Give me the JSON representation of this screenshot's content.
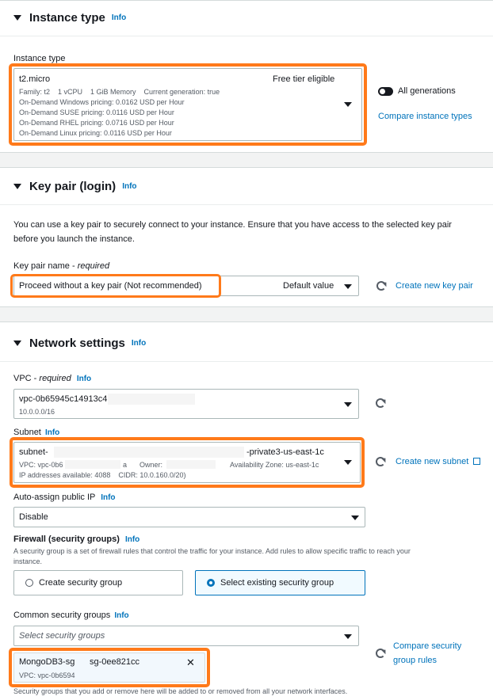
{
  "instance": {
    "title": "Instance type",
    "info": "Info",
    "field_label": "Instance type",
    "selected": "t2.micro",
    "badge": "Free tier eligible",
    "details": [
      "Family: t2    1 vCPU    1 GiB Memory    Current generation: true",
      "On-Demand Windows pricing: 0.0162 USD per Hour",
      "On-Demand SUSE pricing: 0.0116 USD per Hour",
      "On-Demand RHEL pricing: 0.0716 USD per Hour",
      "On-Demand Linux pricing: 0.0116 USD per Hour"
    ],
    "toggle_label": "All generations",
    "compare_link": "Compare instance types"
  },
  "keypair": {
    "title": "Key pair (login)",
    "info": "Info",
    "desc_line1": "You can use a key pair to securely connect to your instance. Ensure that you have access to the selected key pair",
    "desc_line2": "before you launch the instance.",
    "field_label": "Key pair name - ",
    "field_required": "required",
    "selected": "Proceed without a key pair (Not recommended)",
    "default_value": "Default value",
    "create_link": "Create new key pair"
  },
  "network": {
    "title": "Network settings",
    "info": "Info",
    "vpc_label": "VPC - ",
    "vpc_required": "required",
    "vpc_info": "Info",
    "vpc_value": "vpc-0b65945c14913c4",
    "vpc_cidr": "10.0.0.0/16",
    "subnet_label": "Subnet",
    "subnet_info": "Info",
    "subnet_value_start": "subnet-",
    "subnet_value_end": "-private3-us-east-1c",
    "subnet_vpc": "VPC: vpc-0b6",
    "subnet_vpc_end": "a",
    "subnet_owner": "Owner:",
    "subnet_az": "Availability Zone: us-east-1c",
    "subnet_ips": "IP addresses available: 4088    CIDR: 10.0.160.0/20)",
    "subnet_create_link": "Create new subnet",
    "autoassign_label": "Auto-assign public IP",
    "autoassign_info": "Info",
    "autoassign_value": "Disable",
    "firewall_label": "Firewall (security groups)",
    "firewall_info": "Info",
    "firewall_desc_line1": "A security group is a set of firewall rules that control the traffic for your instance. Add rules to allow specific traffic to reach your",
    "firewall_desc_line2": "instance.",
    "option_create": "Create security group",
    "option_existing": "Select existing security group",
    "common_label": "Common security groups",
    "common_info": "Info",
    "common_placeholder": "Select security groups",
    "compare_rules_line1": "Compare security",
    "compare_rules_line2": "group rules",
    "token_name": "MongoDB3-sg",
    "token_id": "sg-0ee821cc",
    "token_vpc": "VPC: vpc-0b6594",
    "close_glyph": "✕",
    "footer_note": "Security groups that you add or remove here will be added to or removed from all your network interfaces."
  }
}
